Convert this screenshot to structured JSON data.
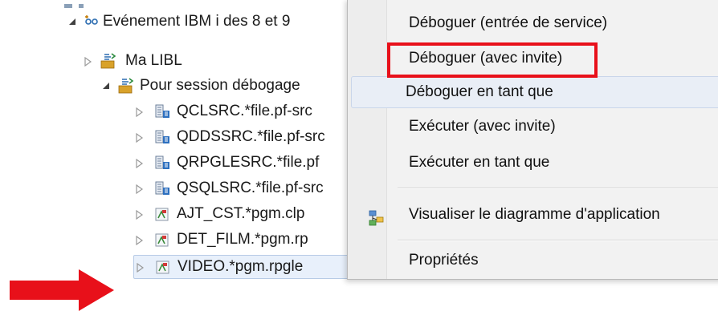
{
  "tree": {
    "items": [
      {
        "label": "Evénement IBM i des 8 et 9",
        "icon": "project-icon",
        "expanded": true
      },
      {
        "label": "Ma LIBL",
        "icon": "library-list-icon",
        "expanded": false
      },
      {
        "label": "Pour session débogage",
        "icon": "filter-folder-icon",
        "expanded": true
      },
      {
        "label": "QCLSRC.*file.pf-src",
        "icon": "source-file-icon",
        "expanded": false
      },
      {
        "label": "QDDSSRC.*file.pf-src",
        "icon": "source-file-icon",
        "expanded": false
      },
      {
        "label": "QRPGLESRC.*file.pf",
        "icon": "source-file-icon",
        "expanded": false
      },
      {
        "label": "QSQLSRC.*file.pf-src",
        "icon": "source-file-icon",
        "expanded": false
      },
      {
        "label": "AJT_CST.*pgm.clp",
        "icon": "program-icon",
        "expanded": false
      },
      {
        "label": "DET_FILM.*pgm.rp",
        "icon": "program-icon",
        "expanded": false
      },
      {
        "label": "VIDEO.*pgm.rpgle",
        "icon": "program-icon",
        "expanded": false,
        "selected": true
      }
    ]
  },
  "context_menu": {
    "items": [
      {
        "label": "Déboguer (entrée de service)",
        "highlighted_box": false
      },
      {
        "label": "Déboguer (avec invite)",
        "highlighted_box": true
      },
      {
        "label": "Déboguer en tant que",
        "hover": true
      },
      {
        "label": "Exécuter (avec invite)"
      },
      {
        "label": "Exécuter en tant que"
      },
      {
        "label": "Visualiser le diagramme d'application",
        "icon": "application-diagram-icon"
      },
      {
        "label": "Propriétés"
      }
    ]
  },
  "annotations": {
    "highlight_color": "#e8101a",
    "arrow_color": "#e8101a"
  }
}
